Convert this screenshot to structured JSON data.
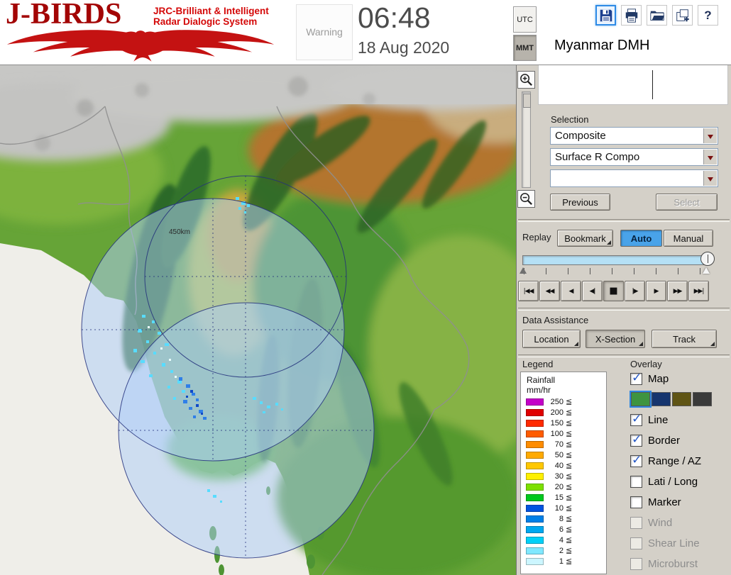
{
  "header": {
    "app_title": "J-BIRDS",
    "tagline1": "JRC-Brilliant & Intelligent",
    "tagline2": "Radar Dialogic System",
    "warning": "Warning",
    "time": "06:48",
    "date": "18 Aug 2020",
    "tz": {
      "utc": "UTC",
      "mmt": "MMT",
      "selected": "MMT"
    },
    "org": "Myanmar DMH",
    "toolbar": {
      "icons": [
        "save-icon",
        "print-icon",
        "open-folder-icon",
        "export-icon",
        "help-icon"
      ],
      "help_glyph": "?"
    }
  },
  "map": {
    "range_label": "450km"
  },
  "selection": {
    "label": "Selection",
    "dropdowns": [
      "Composite",
      "Surface R Compo",
      ""
    ],
    "previous": "Previous",
    "select": "Select"
  },
  "replay": {
    "label": "Replay",
    "bookmark": "Bookmark",
    "auto": "Auto",
    "manual": "Manual",
    "selected_mode": "Auto",
    "transport": [
      {
        "name": "skip-to-start",
        "glyph": "|◀◀"
      },
      {
        "name": "fast-rewind",
        "glyph": "◀◀"
      },
      {
        "name": "play-reverse",
        "glyph": "◀"
      },
      {
        "name": "step-back",
        "glyph": "◀|"
      },
      {
        "name": "stop",
        "glyph": "■",
        "pressed": true
      },
      {
        "name": "step-forward",
        "glyph": "|▶"
      },
      {
        "name": "play",
        "glyph": "▶"
      },
      {
        "name": "fast-forward",
        "glyph": "▶▶"
      },
      {
        "name": "skip-to-end",
        "glyph": "▶▶|"
      }
    ]
  },
  "data_assistance": {
    "label": "Data Assistance",
    "buttons": [
      "Location",
      "X-Section",
      "Track"
    ],
    "pressed": "X-Section"
  },
  "legend": {
    "title": "Legend",
    "product": "Rainfall",
    "unit": "mm/hr",
    "lte": "≦",
    "levels": [
      {
        "value": "250",
        "color": "#c400c8"
      },
      {
        "value": "200",
        "color": "#e00000"
      },
      {
        "value": "150",
        "color": "#ff2a00"
      },
      {
        "value": "100",
        "color": "#ff5c00"
      },
      {
        "value": "70",
        "color": "#ff8c00"
      },
      {
        "value": "50",
        "color": "#ffaa00"
      },
      {
        "value": "40",
        "color": "#ffc800"
      },
      {
        "value": "30",
        "color": "#fff000"
      },
      {
        "value": "20",
        "color": "#7ce000"
      },
      {
        "value": "15",
        "color": "#00c81e"
      },
      {
        "value": "10",
        "color": "#0054e0"
      },
      {
        "value": "8",
        "color": "#0080e8"
      },
      {
        "value": "6",
        "color": "#00a8f0"
      },
      {
        "value": "4",
        "color": "#00d0f8"
      },
      {
        "value": "2",
        "color": "#80e8ff"
      },
      {
        "value": "1",
        "color": "#ccf6ff"
      }
    ]
  },
  "overlay": {
    "title": "Overlay",
    "items": [
      {
        "label": "Map",
        "checked": true,
        "enabled": true
      },
      {
        "label": "Line",
        "checked": true,
        "enabled": true
      },
      {
        "label": "Border",
        "checked": true,
        "enabled": true
      },
      {
        "label": "Range / AZ",
        "checked": true,
        "enabled": true
      },
      {
        "label": "Lati / Long",
        "checked": false,
        "enabled": true
      },
      {
        "label": "Marker",
        "checked": false,
        "enabled": true
      },
      {
        "label": "Wind",
        "checked": false,
        "enabled": false
      },
      {
        "label": "Shear Line",
        "checked": false,
        "enabled": false
      },
      {
        "label": "Microburst",
        "checked": false,
        "enabled": false
      }
    ],
    "map_styles": [
      {
        "name": "terrain",
        "color": "#3e9440",
        "selected": true
      },
      {
        "name": "navy",
        "color": "#16356e",
        "selected": false
      },
      {
        "name": "olive",
        "color": "#5f5414",
        "selected": false
      },
      {
        "name": "dark",
        "color": "#3a3a3a",
        "selected": false
      }
    ]
  },
  "colors": {
    "brand_red": "#c41212",
    "accent_blue": "#49a3e9",
    "panel_bg": "#d4d0c8",
    "replay_track": "#b5e0f5",
    "selected_tool_border": "#2e8be6"
  }
}
